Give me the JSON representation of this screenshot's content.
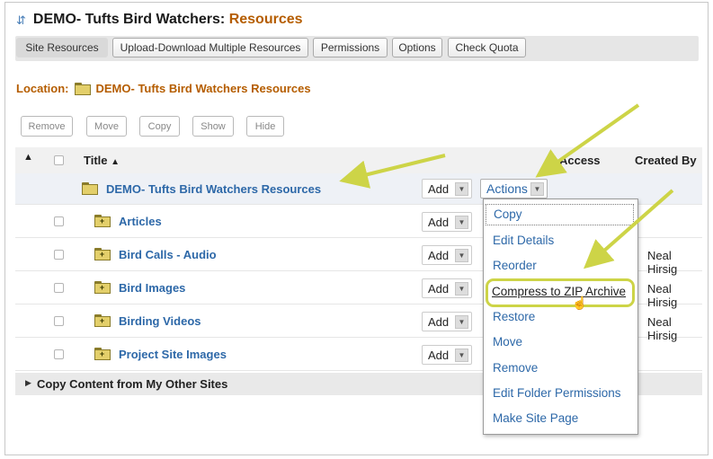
{
  "header": {
    "site_name": "DEMO- Tufts Bird Watchers:",
    "section": "Resources"
  },
  "tabs": [
    {
      "label": "Site Resources"
    },
    {
      "label": "Upload-Download Multiple Resources"
    },
    {
      "label": "Permissions"
    },
    {
      "label": "Options"
    },
    {
      "label": "Check Quota"
    }
  ],
  "location": {
    "label": "Location:",
    "name": "DEMO- Tufts Bird Watchers Resources"
  },
  "toolbar": {
    "remove": "Remove",
    "move": "Move",
    "copy": "Copy",
    "show": "Show",
    "hide": "Hide"
  },
  "table": {
    "col_title": "Title",
    "col_access": "Access",
    "col_created_by": "Created By",
    "parent": {
      "name": "DEMO- Tufts Bird Watchers Resources",
      "add": "Add"
    },
    "rows": [
      {
        "name": "Articles",
        "add": "Add",
        "created_by": ""
      },
      {
        "name": "Bird Calls - Audio",
        "add": "Add",
        "created_by": "Neal Hirsig"
      },
      {
        "name": "Bird Images",
        "add": "Add",
        "created_by": "Neal Hirsig"
      },
      {
        "name": "Birding Videos",
        "add": "Add",
        "created_by": "Neal Hirsig"
      },
      {
        "name": "Project Site Images",
        "add": "Add",
        "created_by": ""
      }
    ]
  },
  "copy_section": {
    "label": "Copy Content from My Other Sites"
  },
  "actions": {
    "label": "Actions",
    "menu": [
      "Copy",
      "Edit Details",
      "Reorder",
      "Compress to ZIP Archive",
      "Restore",
      "Move",
      "Remove",
      "Edit Folder Permissions",
      "Make Site Page"
    ]
  },
  "colors": {
    "accent": "#b55d00",
    "link": "#2d68a8",
    "annotation": "#cdd447"
  },
  "icons": [
    "swap-icon",
    "folder-icon",
    "sort-icon",
    "chevron-down-icon",
    "hand-cursor-icon"
  ]
}
